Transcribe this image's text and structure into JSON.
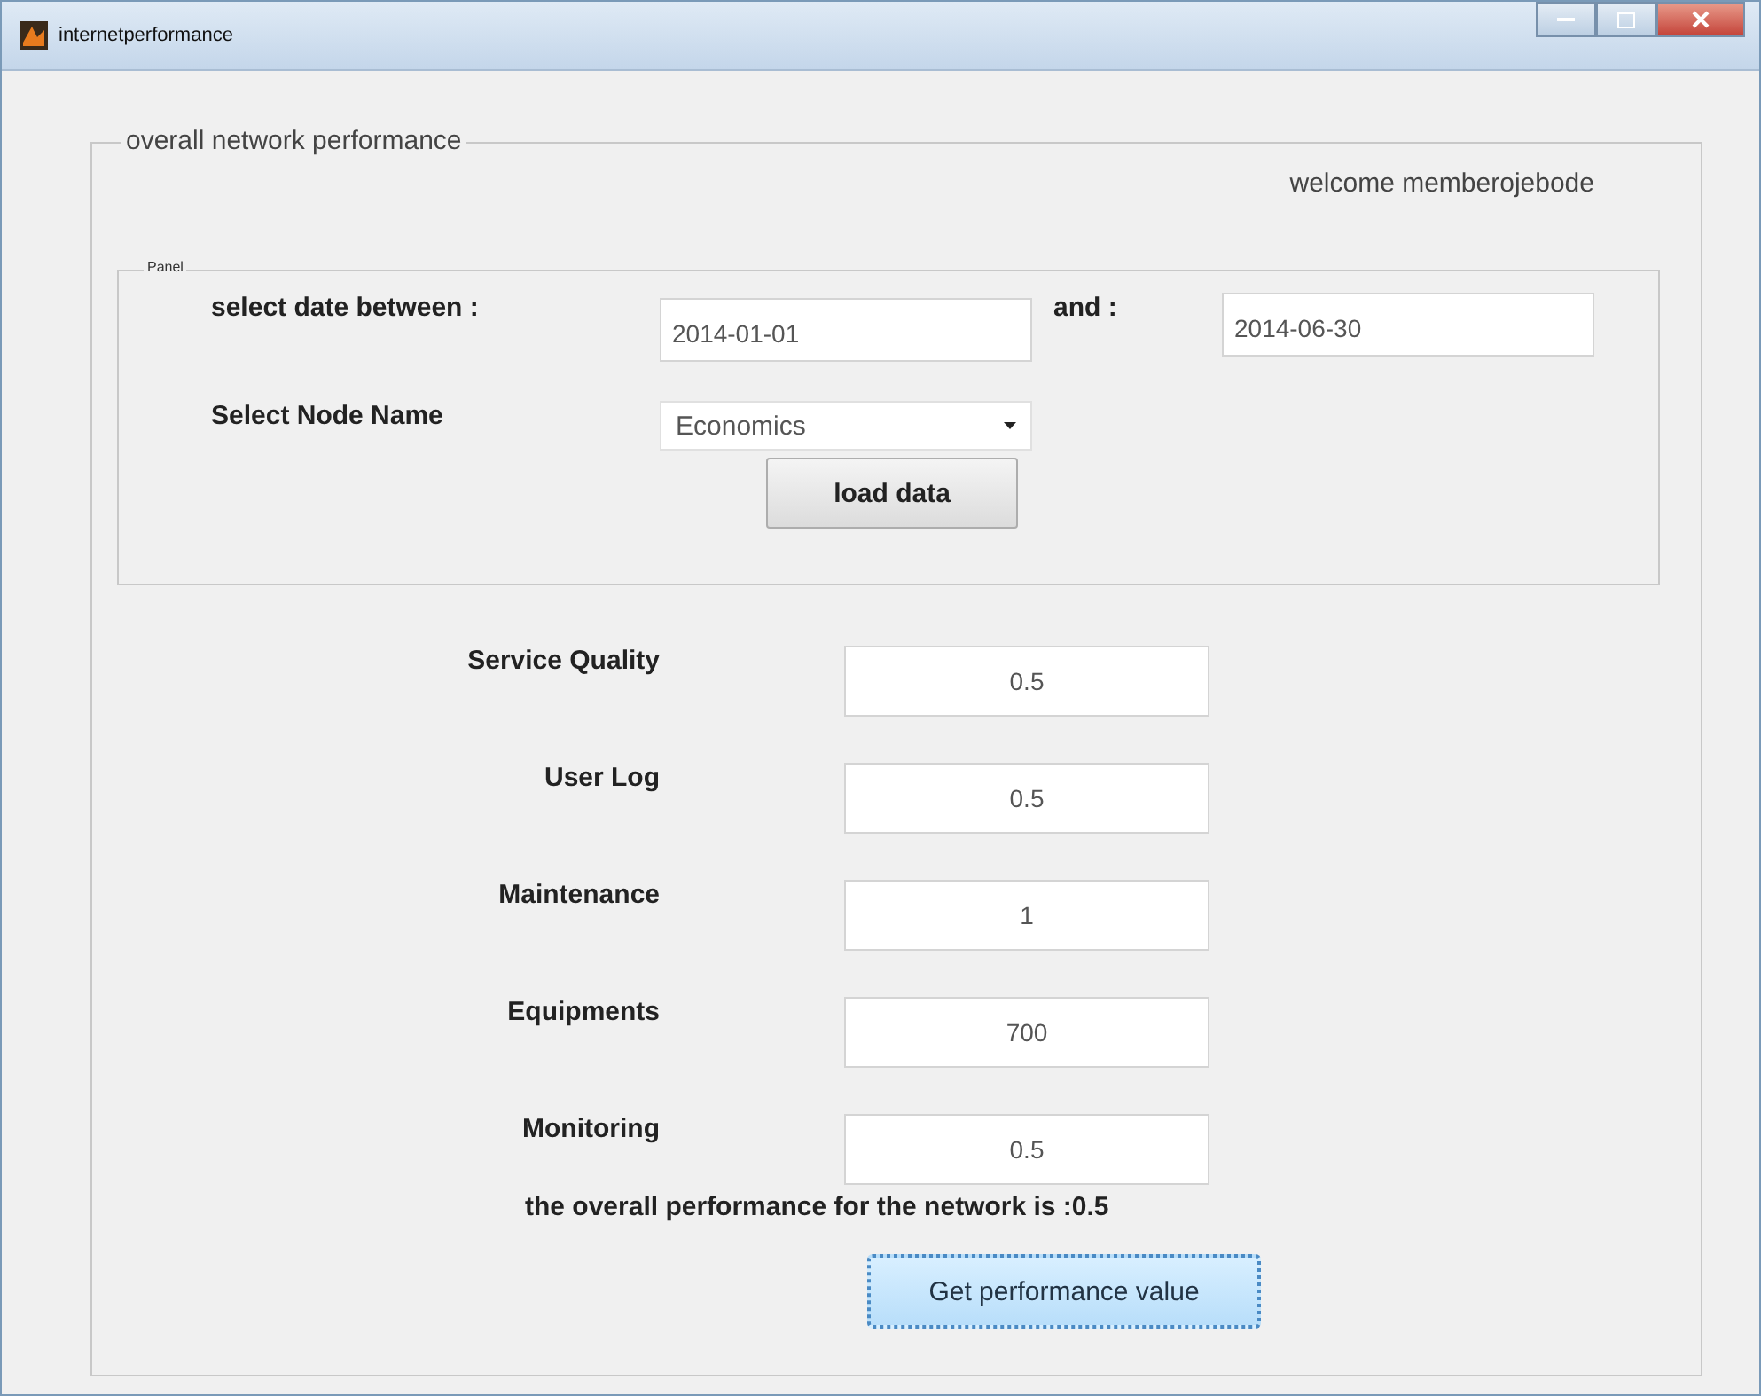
{
  "window": {
    "title": "internetperformance"
  },
  "group": {
    "title": "overall network performance",
    "welcome": "welcome memberojebode"
  },
  "panel": {
    "title": "Panel",
    "date_label": "select date between :",
    "date_from": "2014-01-01",
    "and_label": "and :",
    "date_to": "2014-06-30",
    "node_label": "Select Node Name",
    "node_value": "Economics",
    "load_button": "load data"
  },
  "metrics": [
    {
      "label": "Service Quality",
      "value": "0.5"
    },
    {
      "label": "User Log",
      "value": "0.5"
    },
    {
      "label": "Maintenance",
      "value": "1"
    },
    {
      "label": "Equipments",
      "value": "700"
    },
    {
      "label": "Monitoring",
      "value": "0.5"
    }
  ],
  "result": "the overall performance for the network is :0.5",
  "action_button": {
    "label": "Get performance value",
    "focused": true
  }
}
